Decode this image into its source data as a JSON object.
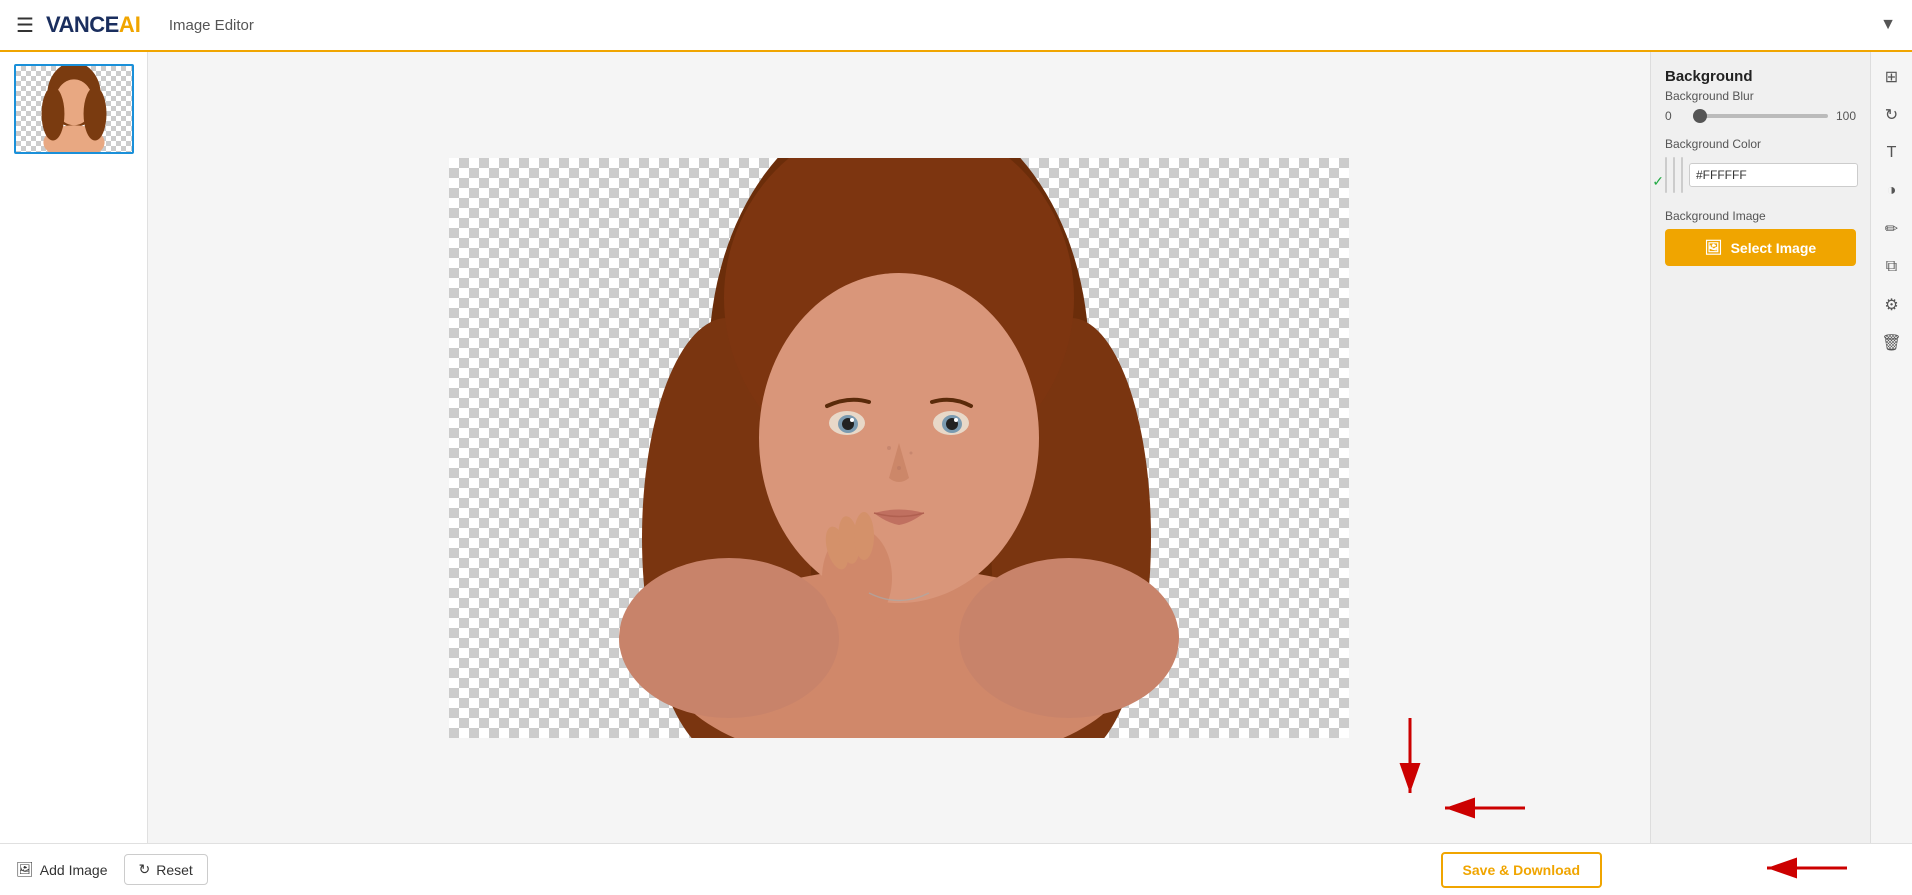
{
  "header": {
    "menu_icon": "☰",
    "logo_vance": "VANCE",
    "logo_ai": "AI",
    "title": "Image Editor",
    "dropdown_icon": "▼"
  },
  "right_panel": {
    "section_title": "Background",
    "blur_label": "Background Blur",
    "blur_min": "0",
    "blur_max": "100",
    "blur_value": 0,
    "color_label": "Background Color",
    "color_hex": "#FFFFFF",
    "image_label": "Background Image",
    "select_image_label": "Select Image",
    "select_image_icon": "🖼"
  },
  "toolbar_icons": [
    {
      "name": "crop-icon",
      "symbol": "⊞"
    },
    {
      "name": "refresh-icon",
      "symbol": "↻"
    },
    {
      "name": "text-icon",
      "symbol": "T"
    },
    {
      "name": "filter-icon",
      "symbol": "◑"
    },
    {
      "name": "pen-icon",
      "symbol": "✏"
    },
    {
      "name": "layers-icon",
      "symbol": "⧉"
    },
    {
      "name": "settings-icon",
      "symbol": "⚙"
    },
    {
      "name": "delete-icon",
      "symbol": "🗑"
    }
  ],
  "bottom_bar": {
    "add_image_label": "Add Image",
    "reset_label": "Reset",
    "save_download_label": "Save & Download"
  },
  "colors": {
    "accent_orange": "#f0a500",
    "logo_blue": "#1a2e5e",
    "select_btn_bg": "#f0a500",
    "arrow_red": "#cc0000"
  }
}
